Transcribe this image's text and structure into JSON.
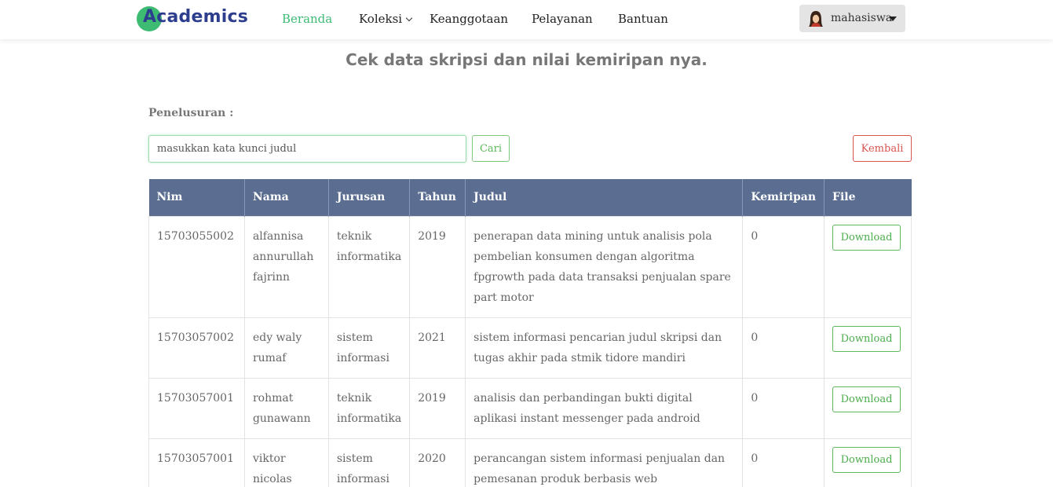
{
  "header": {
    "logo_text": "Academics",
    "nav": [
      "Beranda",
      "Koleksi",
      "Keanggotaan",
      "Pelayanan",
      "Bantuan"
    ],
    "user": "mahasiswa",
    "colors": {
      "accent": "#3dbb73",
      "logo": "#2d3e8f"
    }
  },
  "page": {
    "title": "Cek data skripsi dan nilai kemiripan nya.",
    "search_label": "Penelusuran :",
    "search_placeholder": "masukkan kata kunci judul",
    "search_button": "Cari",
    "back_button": "Kembali"
  },
  "table": {
    "headers": [
      "Nim",
      "Nama",
      "Jurusan",
      "Tahun",
      "Judul",
      "Kemiripan",
      "File"
    ],
    "download_label": "Download",
    "rows": [
      [
        "15703055002",
        "alfannisa annurullah fajrinn",
        "teknik informatika",
        "2019",
        "penerapan data mining untuk analisis pola pembelian konsumen dengan algoritma fpgrowth pada data transaksi penjualan spare part motor",
        "0"
      ],
      [
        "15703057002",
        "edy waly rumaf",
        "sistem informasi",
        "2021",
        "sistem informasi pencarian judul skripsi dan tugas akhir pada stmik tidore mandiri",
        "0"
      ],
      [
        "15703057001",
        "rohmat gunawann",
        "teknik informatika",
        "2019",
        "analisis dan perbandingan bukti digital aplikasi instant messenger pada android",
        "0"
      ],
      [
        "15703057001",
        "viktor nicolas",
        "sistem informasi",
        "2020",
        "perancangan sistem informasi penjualan dan pemesanan produk berbasis web",
        "0"
      ]
    ]
  }
}
